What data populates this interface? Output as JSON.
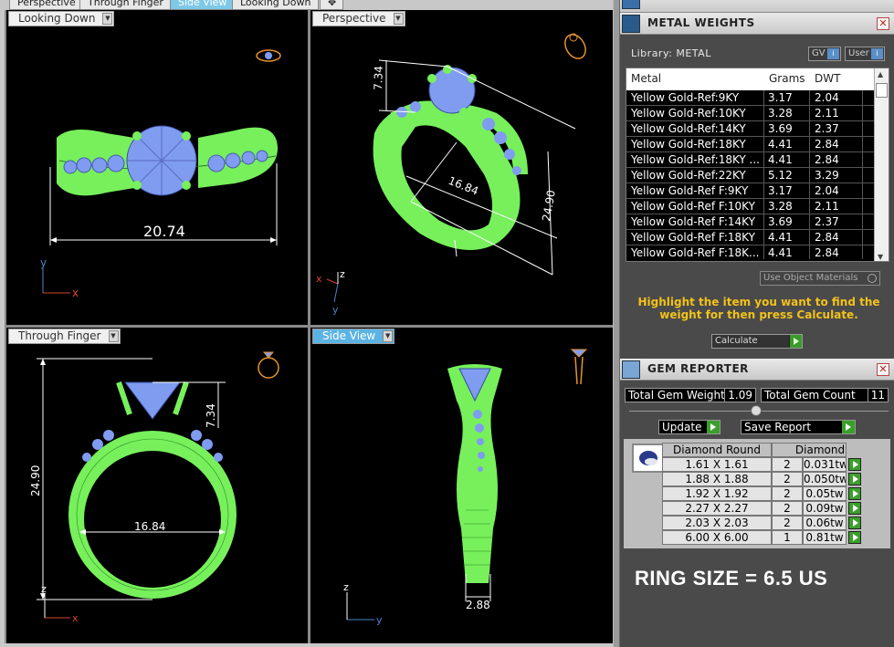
{
  "tabs": [
    {
      "label": "Perspective",
      "active": false
    },
    {
      "label": "Through Finger",
      "active": false
    },
    {
      "label": "Side View",
      "active": true
    },
    {
      "label": "Looking Down",
      "active": false
    }
  ],
  "viewports": {
    "top_left": {
      "label": "Looking Down",
      "dimension": "20.74",
      "axis_x": "x",
      "axis_y": "y"
    },
    "top_right": {
      "label": "Perspective",
      "dim_height": "7.34",
      "dim_inner": "16.84",
      "dim_outer": "24.90",
      "axis_x": "x",
      "axis_y": "y",
      "axis_z": "z"
    },
    "bottom_left": {
      "label": "Through Finger",
      "dim_height": "24.90",
      "dim_top": "7.34",
      "dim_inner": "16.84",
      "axis_x": "x",
      "axis_z": "z"
    },
    "bottom_right": {
      "label": "Side View",
      "dim_width": "2.88",
      "axis_y": "y",
      "axis_z": "z"
    }
  },
  "colors": {
    "ring_metal": "#77f05c",
    "gem": "#7f9cf0",
    "axis_red": "#d8442b",
    "axis_blue": "#4a86c8",
    "hint": "#f2c21a",
    "active_tab": "#5bb3e3"
  },
  "panel": {
    "top_title": "METAL WEIGHTS",
    "metal_weights": {
      "library_label": "Library: METAL",
      "gv_button": "GV",
      "user_button": "User",
      "columns": [
        "Metal",
        "Grams",
        "DWT"
      ],
      "rows": [
        {
          "metal": "Yellow Gold-Ref:9KY",
          "grams": "3.17",
          "dwt": "2.04"
        },
        {
          "metal": "Yellow Gold-Ref:10KY",
          "grams": "3.28",
          "dwt": "2.11"
        },
        {
          "metal": "Yellow Gold-Ref:14KY",
          "grams": "3.69",
          "dwt": "2.37"
        },
        {
          "metal": "Yellow Gold-Ref:18KY",
          "grams": "4.41",
          "dwt": "2.84"
        },
        {
          "metal": "Yellow Gold-Ref:18KY ...",
          "grams": "4.41",
          "dwt": "2.84"
        },
        {
          "metal": "Yellow Gold-Ref:22KY",
          "grams": "5.12",
          "dwt": "3.29"
        },
        {
          "metal": "Yellow Gold-Ref F:9KY",
          "grams": "3.17",
          "dwt": "2.04"
        },
        {
          "metal": "Yellow Gold-Ref F:10KY",
          "grams": "3.28",
          "dwt": "2.11"
        },
        {
          "metal": "Yellow Gold-Ref F:14KY",
          "grams": "3.69",
          "dwt": "2.37"
        },
        {
          "metal": "Yellow Gold-Ref F:18KY",
          "grams": "4.41",
          "dwt": "2.84"
        },
        {
          "metal": "Yellow Gold-Ref F:18K...",
          "grams": "4.41",
          "dwt": "2.84"
        }
      ],
      "use_object_materials": "Use Object Materials",
      "hint": "Highlight the item you want to find the weight for then press Calculate.",
      "calculate_button": "Calculate"
    },
    "gem_reporter": {
      "title": "GEM REPORTER",
      "total_gem_weight_label": "Total Gem Weight",
      "total_gem_weight": "1.09",
      "total_gem_count_label": "Total Gem Count",
      "total_gem_count": "11",
      "update_button": "Update",
      "save_report_button": "Save Report",
      "columns": [
        "Diamond Round",
        "Diamond"
      ],
      "rows": [
        {
          "size": "1.61 X 1.61",
          "count": "2",
          "weight": "0.031tw"
        },
        {
          "size": "1.88 X 1.88",
          "count": "2",
          "weight": "0.050tw"
        },
        {
          "size": "1.92 X 1.92",
          "count": "2",
          "weight": "0.05tw"
        },
        {
          "size": "2.27 X 2.27",
          "count": "2",
          "weight": "0.09tw"
        },
        {
          "size": "2.03 X 2.03",
          "count": "2",
          "weight": "0.06tw"
        },
        {
          "size": "6.00 X 6.00",
          "count": "1",
          "weight": "0.81tw"
        }
      ]
    },
    "ring_size": "RING SIZE = 6.5 US"
  }
}
